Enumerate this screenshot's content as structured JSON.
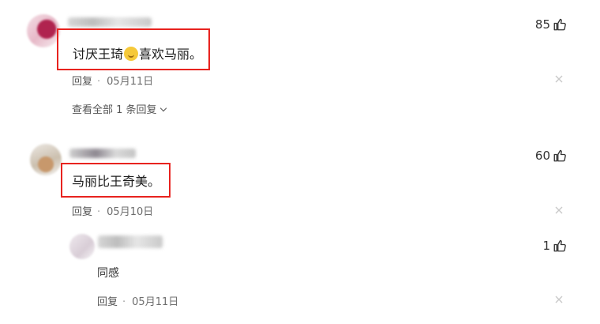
{
  "comments": [
    {
      "text_before_emoji": "讨厌王琦",
      "emoji": "smiling-face",
      "text_after_emoji": "喜欢马丽。",
      "likes": "85",
      "reply_label": "回复",
      "date": "05月11日",
      "view_replies": "查看全部 1 条回复"
    },
    {
      "text": "马丽比王奇美。",
      "likes": "60",
      "reply_label": "回复",
      "date": "05月10日",
      "replies": [
        {
          "text": "同感",
          "likes": "1",
          "reply_label": "回复",
          "date": "05月11日"
        }
      ]
    }
  ],
  "colors": {
    "highlight": "#e8231f",
    "meta_text": "#6d6d6d"
  }
}
